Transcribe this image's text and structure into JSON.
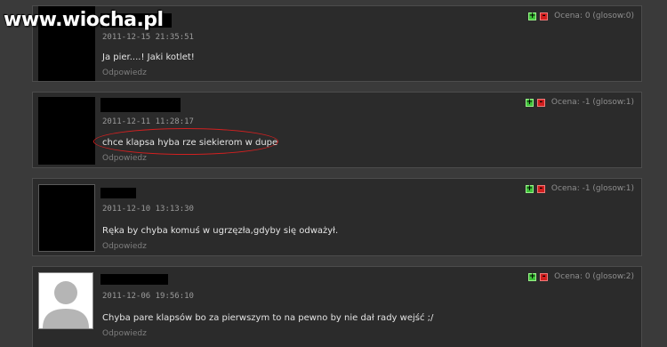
{
  "watermark": "www.wiocha.pl",
  "vote_icons": {
    "up": "+",
    "down": "-"
  },
  "colors": {
    "up": "#3fc33a",
    "down": "#d21e1e",
    "highlight": "#d12020"
  },
  "comments": [
    {
      "date": "2011-12-15 21:35:51",
      "text": "Ja pier....! Jaki kotlet!",
      "reply": "Odpowiedz",
      "score": "Ocena: 0 (glosow:0)"
    },
    {
      "date": "2011-12-11 11:28:17",
      "text": "chce klapsa hyba rze siekierom w dupe",
      "reply": "Odpowiedz",
      "score": "Ocena: -1 (glosow:1)"
    },
    {
      "date": "2011-12-10 13:13:30",
      "text": "Ręka by chyba komuś w ugrzęzła,gdyby się odważył.",
      "reply": "Odpowiedz",
      "score": "Ocena: -1 (glosow:1)"
    },
    {
      "date": "2011-12-06 19:56:10",
      "text": "Chyba pare klapsów bo za pierwszym to na pewno by nie dał rady wejść ;/",
      "reply": "Odpowiedz",
      "score": "Ocena: 0 (glosow:2)"
    }
  ]
}
